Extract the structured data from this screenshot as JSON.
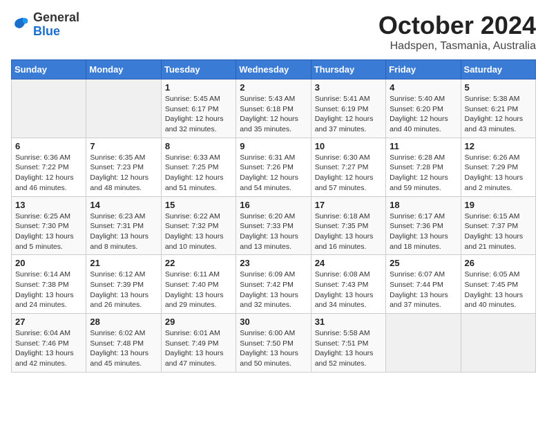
{
  "logo": {
    "general": "General",
    "blue": "Blue"
  },
  "title": "October 2024",
  "subtitle": "Hadspen, Tasmania, Australia",
  "days_of_week": [
    "Sunday",
    "Monday",
    "Tuesday",
    "Wednesday",
    "Thursday",
    "Friday",
    "Saturday"
  ],
  "weeks": [
    [
      {
        "day": "",
        "info": ""
      },
      {
        "day": "",
        "info": ""
      },
      {
        "day": "1",
        "info": "Sunrise: 5:45 AM\nSunset: 6:17 PM\nDaylight: 12 hours and 32 minutes."
      },
      {
        "day": "2",
        "info": "Sunrise: 5:43 AM\nSunset: 6:18 PM\nDaylight: 12 hours and 35 minutes."
      },
      {
        "day": "3",
        "info": "Sunrise: 5:41 AM\nSunset: 6:19 PM\nDaylight: 12 hours and 37 minutes."
      },
      {
        "day": "4",
        "info": "Sunrise: 5:40 AM\nSunset: 6:20 PM\nDaylight: 12 hours and 40 minutes."
      },
      {
        "day": "5",
        "info": "Sunrise: 5:38 AM\nSunset: 6:21 PM\nDaylight: 12 hours and 43 minutes."
      }
    ],
    [
      {
        "day": "6",
        "info": "Sunrise: 6:36 AM\nSunset: 7:22 PM\nDaylight: 12 hours and 46 minutes."
      },
      {
        "day": "7",
        "info": "Sunrise: 6:35 AM\nSunset: 7:23 PM\nDaylight: 12 hours and 48 minutes."
      },
      {
        "day": "8",
        "info": "Sunrise: 6:33 AM\nSunset: 7:25 PM\nDaylight: 12 hours and 51 minutes."
      },
      {
        "day": "9",
        "info": "Sunrise: 6:31 AM\nSunset: 7:26 PM\nDaylight: 12 hours and 54 minutes."
      },
      {
        "day": "10",
        "info": "Sunrise: 6:30 AM\nSunset: 7:27 PM\nDaylight: 12 hours and 57 minutes."
      },
      {
        "day": "11",
        "info": "Sunrise: 6:28 AM\nSunset: 7:28 PM\nDaylight: 12 hours and 59 minutes."
      },
      {
        "day": "12",
        "info": "Sunrise: 6:26 AM\nSunset: 7:29 PM\nDaylight: 13 hours and 2 minutes."
      }
    ],
    [
      {
        "day": "13",
        "info": "Sunrise: 6:25 AM\nSunset: 7:30 PM\nDaylight: 13 hours and 5 minutes."
      },
      {
        "day": "14",
        "info": "Sunrise: 6:23 AM\nSunset: 7:31 PM\nDaylight: 13 hours and 8 minutes."
      },
      {
        "day": "15",
        "info": "Sunrise: 6:22 AM\nSunset: 7:32 PM\nDaylight: 13 hours and 10 minutes."
      },
      {
        "day": "16",
        "info": "Sunrise: 6:20 AM\nSunset: 7:33 PM\nDaylight: 13 hours and 13 minutes."
      },
      {
        "day": "17",
        "info": "Sunrise: 6:18 AM\nSunset: 7:35 PM\nDaylight: 13 hours and 16 minutes."
      },
      {
        "day": "18",
        "info": "Sunrise: 6:17 AM\nSunset: 7:36 PM\nDaylight: 13 hours and 18 minutes."
      },
      {
        "day": "19",
        "info": "Sunrise: 6:15 AM\nSunset: 7:37 PM\nDaylight: 13 hours and 21 minutes."
      }
    ],
    [
      {
        "day": "20",
        "info": "Sunrise: 6:14 AM\nSunset: 7:38 PM\nDaylight: 13 hours and 24 minutes."
      },
      {
        "day": "21",
        "info": "Sunrise: 6:12 AM\nSunset: 7:39 PM\nDaylight: 13 hours and 26 minutes."
      },
      {
        "day": "22",
        "info": "Sunrise: 6:11 AM\nSunset: 7:40 PM\nDaylight: 13 hours and 29 minutes."
      },
      {
        "day": "23",
        "info": "Sunrise: 6:09 AM\nSunset: 7:42 PM\nDaylight: 13 hours and 32 minutes."
      },
      {
        "day": "24",
        "info": "Sunrise: 6:08 AM\nSunset: 7:43 PM\nDaylight: 13 hours and 34 minutes."
      },
      {
        "day": "25",
        "info": "Sunrise: 6:07 AM\nSunset: 7:44 PM\nDaylight: 13 hours and 37 minutes."
      },
      {
        "day": "26",
        "info": "Sunrise: 6:05 AM\nSunset: 7:45 PM\nDaylight: 13 hours and 40 minutes."
      }
    ],
    [
      {
        "day": "27",
        "info": "Sunrise: 6:04 AM\nSunset: 7:46 PM\nDaylight: 13 hours and 42 minutes."
      },
      {
        "day": "28",
        "info": "Sunrise: 6:02 AM\nSunset: 7:48 PM\nDaylight: 13 hours and 45 minutes."
      },
      {
        "day": "29",
        "info": "Sunrise: 6:01 AM\nSunset: 7:49 PM\nDaylight: 13 hours and 47 minutes."
      },
      {
        "day": "30",
        "info": "Sunrise: 6:00 AM\nSunset: 7:50 PM\nDaylight: 13 hours and 50 minutes."
      },
      {
        "day": "31",
        "info": "Sunrise: 5:58 AM\nSunset: 7:51 PM\nDaylight: 13 hours and 52 minutes."
      },
      {
        "day": "",
        "info": ""
      },
      {
        "day": "",
        "info": ""
      }
    ]
  ]
}
